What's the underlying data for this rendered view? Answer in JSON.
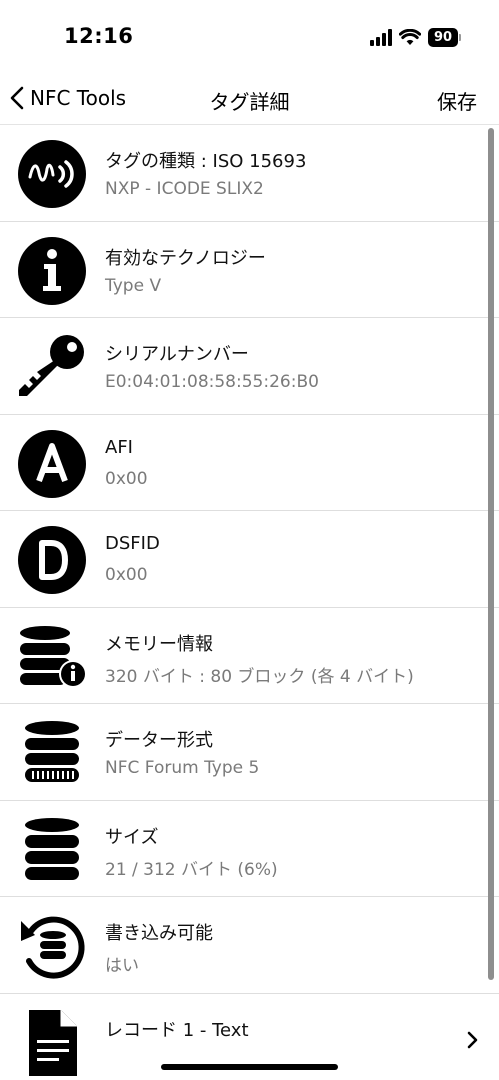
{
  "status_bar": {
    "time": "12:16",
    "battery": "90"
  },
  "nav": {
    "back_label": "NFC Tools",
    "title": "タグ詳細",
    "save_label": "保存"
  },
  "rows": [
    {
      "icon": "nfc-wave-icon",
      "title": "タグの種類 : ISO 15693",
      "subtitle": "NXP - ICODE SLIX2"
    },
    {
      "icon": "info-icon",
      "title": "有効なテクノロジー",
      "subtitle": "Type V"
    },
    {
      "icon": "key-icon",
      "title": "シリアルナンバー",
      "subtitle": "E0:04:01:08:58:55:26:B0"
    },
    {
      "icon": "letter-a-icon",
      "title": "AFI",
      "subtitle": "0x00"
    },
    {
      "icon": "letter-d-icon",
      "title": "DSFID",
      "subtitle": "0x00"
    },
    {
      "icon": "database-info-icon",
      "title": "メモリー情報",
      "subtitle": "320 バイト : 80 ブロック (各 4 バイト)"
    },
    {
      "icon": "database-format-icon",
      "title": "データー形式",
      "subtitle": "NFC Forum Type 5"
    },
    {
      "icon": "database-icon",
      "title": "サイズ",
      "subtitle": "21 / 312 バイト (6%)"
    },
    {
      "icon": "database-writable-icon",
      "title": "書き込み可能",
      "subtitle": "はい"
    },
    {
      "icon": "document-icon",
      "title": "レコード 1 - Text",
      "subtitle": ""
    }
  ]
}
